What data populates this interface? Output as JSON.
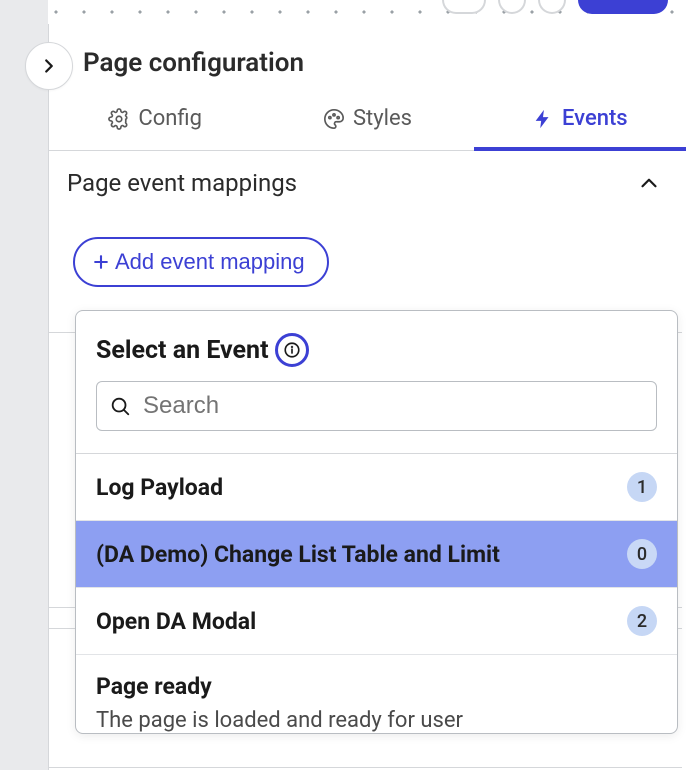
{
  "panel": {
    "title": "Page configuration"
  },
  "tabs": {
    "config": "Config",
    "styles": "Styles",
    "events": "Events"
  },
  "section": {
    "title": "Page event mappings"
  },
  "buttons": {
    "add_event_mapping": "Add event mapping"
  },
  "popup": {
    "title": "Select an Event",
    "search_placeholder": "Search",
    "events": [
      {
        "label": "Log Payload",
        "count": "1",
        "selected": false
      },
      {
        "label": "(DA Demo) Change List Table and Limit",
        "count": "0",
        "selected": true
      },
      {
        "label": "Open DA Modal",
        "count": "2",
        "selected": false
      }
    ],
    "page_ready": {
      "title": "Page ready",
      "desc": "The page is loaded and ready for user"
    }
  },
  "colors": {
    "accent": "#3c40d4",
    "badge_bg": "#c6d7f5",
    "selected_bg": "#8d9ff2"
  }
}
